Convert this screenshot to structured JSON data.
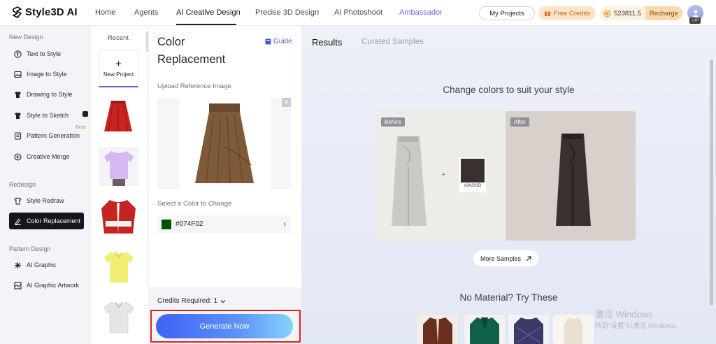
{
  "brand": {
    "name": "Style3D AI"
  },
  "nav": {
    "items": [
      "Home",
      "Agents",
      "AI Creative Design",
      "Precise 3D Design",
      "AI Photoshoot",
      "Ambassador"
    ],
    "active": "AI Creative Design",
    "my_projects": "My Projects",
    "free_credits": "Free Credits",
    "balance": "523811.5",
    "recharge": "Recharge",
    "vip": "VIP"
  },
  "sidebar": {
    "sections": [
      {
        "title": "New Design",
        "items": [
          "Text to Style",
          "Image to Style",
          "Drawing to Style",
          "Style to Sketch",
          "Pattern Generation",
          "Creative Merge"
        ]
      },
      {
        "title": "Redesign",
        "items": [
          "Style Redraw",
          "Color Replacement"
        ]
      },
      {
        "title": "Pattern Design",
        "items": [
          "AI Graphic",
          "AI Graphic Artwork"
        ]
      }
    ],
    "active": "Color Replacement",
    "beta": "Beta"
  },
  "recent": {
    "title": "Recent",
    "new_project": "New Project",
    "plus": "+"
  },
  "panel": {
    "title": "Color Replacement",
    "guide": "Guide",
    "upload_label": "Upload Reference Image",
    "color_label": "Select a Color to Change",
    "selected_color": "#074F02",
    "credits_required": "Credits Required: 1",
    "generate": "Generate Now"
  },
  "results": {
    "tabs": [
      "Results",
      "Curated Samples"
    ],
    "headline": "Change colors to suit your style",
    "before": "Before",
    "after": "After",
    "sample_hex": "#3A302D",
    "more_samples": "More Samples",
    "no_material": "No Material? Try These"
  },
  "watermark": {
    "line1": "激活 Windows",
    "line2": "转到\"设置\"以激活 Windows。"
  },
  "colors": {
    "accent": "#4a5bd7",
    "active_nav": "#15171c",
    "generate_start": "#3f62f5",
    "generate_end": "#86d4fb",
    "highlight": "#e02020"
  }
}
